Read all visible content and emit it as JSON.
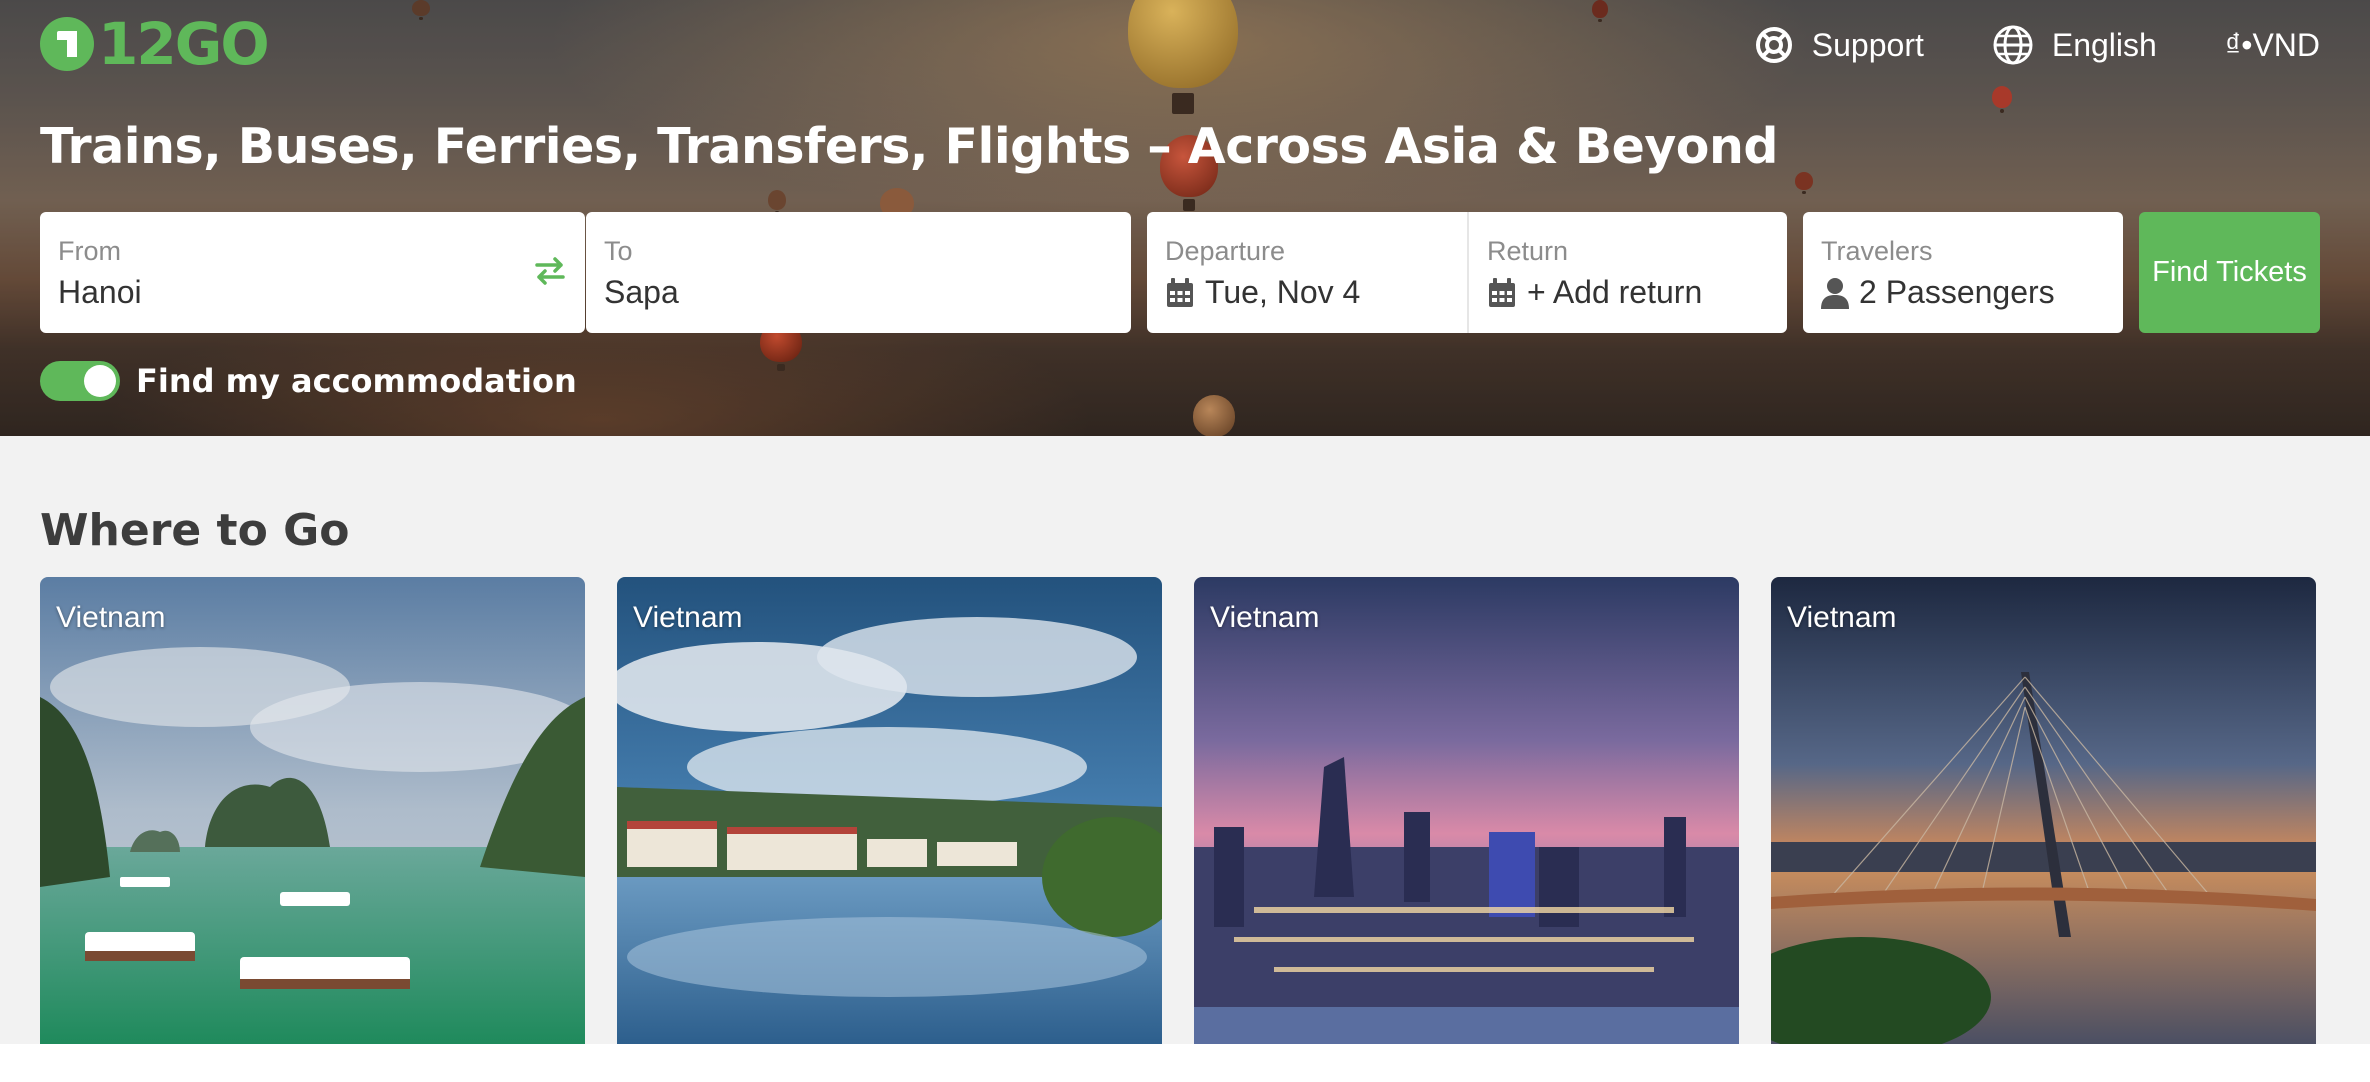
{
  "brand": {
    "logo_text": "12GO",
    "accent": "#5fb85a"
  },
  "topnav": {
    "support_label": "Support",
    "language_label": "English",
    "currency_label": "₫•VND"
  },
  "hero": {
    "headline": "Trains, Buses, Ferries, Transfers, Flights – Across Asia & Beyond"
  },
  "search": {
    "from": {
      "label": "From",
      "value": "Hanoi"
    },
    "to": {
      "label": "To",
      "value": "Sapa"
    },
    "departure": {
      "label": "Departure",
      "value": "Tue, Nov 4"
    },
    "return": {
      "label": "Return",
      "value": "+ Add return"
    },
    "travelers": {
      "label": "Travelers",
      "value": "2 Passengers"
    },
    "find_label": "Find Tickets"
  },
  "accommodation": {
    "label": "Find my accommodation",
    "enabled": true
  },
  "where_to_go": {
    "title": "Where to Go",
    "cards": [
      {
        "country": "Vietnam",
        "scene": "bay-with-boats"
      },
      {
        "country": "Vietnam",
        "scene": "lake-town"
      },
      {
        "country": "Vietnam",
        "scene": "city-skyline-dusk"
      },
      {
        "country": "Vietnam",
        "scene": "cable-bridge-sunset"
      }
    ]
  }
}
